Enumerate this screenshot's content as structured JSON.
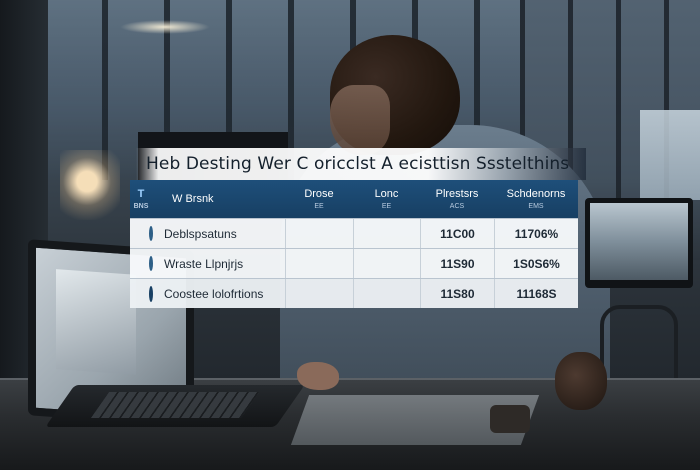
{
  "title": "Heb Desting Wer C oricclst A ecisttisn Ssstelthins",
  "table": {
    "header": {
      "icon_label": "T",
      "icon_sub": "BNS",
      "col1": "W Brsnk",
      "col2": "Drose",
      "col2_sub": "EE",
      "col3": "Lonc",
      "col3_sub": "EE",
      "col4": "Plrestsrs",
      "col4_sub": "ACS",
      "col5": "Schdenorns",
      "col5_sub": "EMS"
    },
    "rows": [
      {
        "icon": "gear-badge-icon",
        "name": "Deblspsatuns",
        "col2": "",
        "col3": "",
        "col4": "11C00",
        "col5": "11706%"
      },
      {
        "icon": "gear-badge-icon",
        "name": "Wraste Llpnjrjs",
        "col2": "",
        "col3": "",
        "col4": "11S90",
        "col5": "1S0S6%"
      },
      {
        "icon": "pill-badge-icon",
        "name": "Coostee lolofrtions",
        "col2": "",
        "col3": "",
        "col4": "11S80",
        "col5": "11168S"
      }
    ]
  },
  "colors": {
    "header_bg": "#1e4f7a",
    "row_bg": "#f7f9fb",
    "accent": "#2d5f87"
  }
}
